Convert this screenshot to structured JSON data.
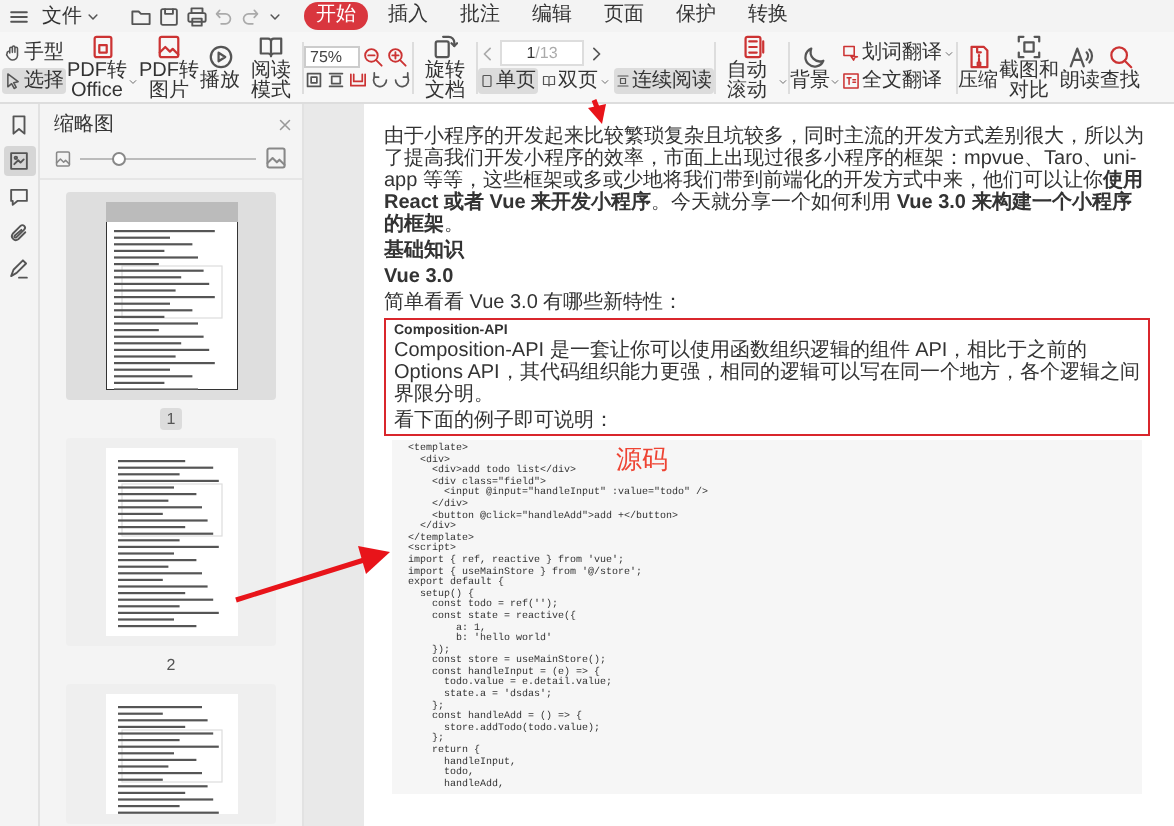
{
  "menu": {
    "file": "文件",
    "tabs": [
      {
        "label": "开始",
        "selected": true
      },
      {
        "label": "插入",
        "selected": false
      },
      {
        "label": "批注",
        "selected": false
      },
      {
        "label": "编辑",
        "selected": false
      },
      {
        "label": "页面",
        "selected": false
      },
      {
        "label": "保护",
        "selected": false
      },
      {
        "label": "转换",
        "selected": false
      }
    ]
  },
  "toolbar": {
    "items": [
      {
        "kind": "stack",
        "entries": [
          {
            "label": "手型",
            "selected": false
          },
          {
            "label": "选择",
            "selected": true
          }
        ]
      },
      {
        "kind": "big",
        "label": "PDF转Office",
        "dropdown": true
      },
      {
        "kind": "big",
        "label": "PDF转图片",
        "dropdown": false
      },
      {
        "kind": "big",
        "label": "播放",
        "dropdown": false
      },
      {
        "kind": "big",
        "label": "阅读模式",
        "dropdown": false
      },
      {
        "kind": "zoom",
        "value": "75%"
      },
      {
        "kind": "big",
        "label": "旋转文档",
        "dropdown": false
      },
      {
        "kind": "pager",
        "page": "1",
        "total": "/13",
        "modes": [
          {
            "label": "单页",
            "selected": true,
            "dropdown": false
          },
          {
            "label": "双页",
            "selected": false,
            "dropdown": true
          },
          {
            "label": "连续阅读",
            "selected": true,
            "dropdown": false
          }
        ]
      },
      {
        "kind": "big",
        "label": "自动滚动",
        "dropdown": true
      },
      {
        "kind": "big",
        "label": "背景",
        "dropdown": true
      },
      {
        "kind": "stack",
        "entries": [
          {
            "label": "划词翻译",
            "dropdown": true
          },
          {
            "label": "全文翻译",
            "dropdown": false
          }
        ]
      },
      {
        "kind": "big",
        "label": "压缩",
        "dropdown": false
      },
      {
        "kind": "big",
        "label": "截图和对比",
        "dropdown": false
      },
      {
        "kind": "big",
        "label": "朗读",
        "dropdown": false
      },
      {
        "kind": "big",
        "label": "查找",
        "dropdown": false
      }
    ]
  },
  "rail": [
    {
      "kind": "bookmark",
      "selected": false
    },
    {
      "kind": "thumbnail",
      "selected": true
    },
    {
      "kind": "comment",
      "selected": false
    },
    {
      "kind": "attachment",
      "selected": false
    },
    {
      "kind": "signature",
      "selected": false
    }
  ],
  "thumbnails": {
    "title": "缩略图",
    "slider": {
      "level": 0.22
    },
    "pages": [
      {
        "label": "1",
        "selected": true
      },
      {
        "label": "2",
        "selected": false
      },
      {
        "selected": false
      }
    ]
  },
  "document": {
    "blocks": [
      {
        "kind": "paragraph",
        "text": "由于小程序的开发起来比较繁琐复杂且坑较多，同时主流的开发方式差别很大，所以为了提高我们开发小程序的效率，市面上出现过很多小程序的框架：mpvue、Taro、uni-app 等等，这些框架或多或少地将我们带到前端化的开发方式中来，他们可以让你**使用 React 或者 Vue 来开发小程序**。今天就分享一个如何利用 **Vue 3.0 来构建一个小程序的框架**。"
      },
      {
        "kind": "heading",
        "text": "基础知识"
      },
      {
        "kind": "heading",
        "text": "Vue 3.0"
      },
      {
        "kind": "paragraph",
        "text": "简单看看 Vue 3.0 有哪些新特性："
      }
    ],
    "callout": {
      "title": "Composition-API",
      "text": "Composition-API 是一套让你可以使用函数组织逻辑的组件 API，相比于之前的 Options API，其代码组织能力更强，相同的逻辑可以写在同一个地方，各个逻辑之间界限分明。",
      "note": "看下面的例子即可说明："
    },
    "code": [
      "<template>",
      "  <div>",
      "    <div>add todo list</div>",
      "    <div class=\"field\">",
      "      <input @input=\"handleInput\" :value=\"todo\" />",
      "    </div>",
      "    <button @click=\"handleAdd\">add +</button>",
      "  </div>",
      "</template>",
      "<script>",
      "import { ref, reactive } from 'vue';",
      "import { useMainStore } from '@/store';",
      "export default {",
      "  setup() {",
      "    const todo = ref('');",
      "    const state = reactive({",
      "        a: 1,",
      "        b: 'hello world'",
      "    });",
      "    const store = useMainStore();",
      "    const handleInput = (e) => {",
      "      todo.value = e.detail.value;",
      "      state.a = 'dsdas';",
      "    };",
      "    const handleAdd = () => {",
      "      store.addTodo(todo.value);",
      "    };",
      "    return {",
      "      handleInput,",
      "      todo,",
      "      handleAdd,"
    ],
    "annotation": "源码"
  }
}
